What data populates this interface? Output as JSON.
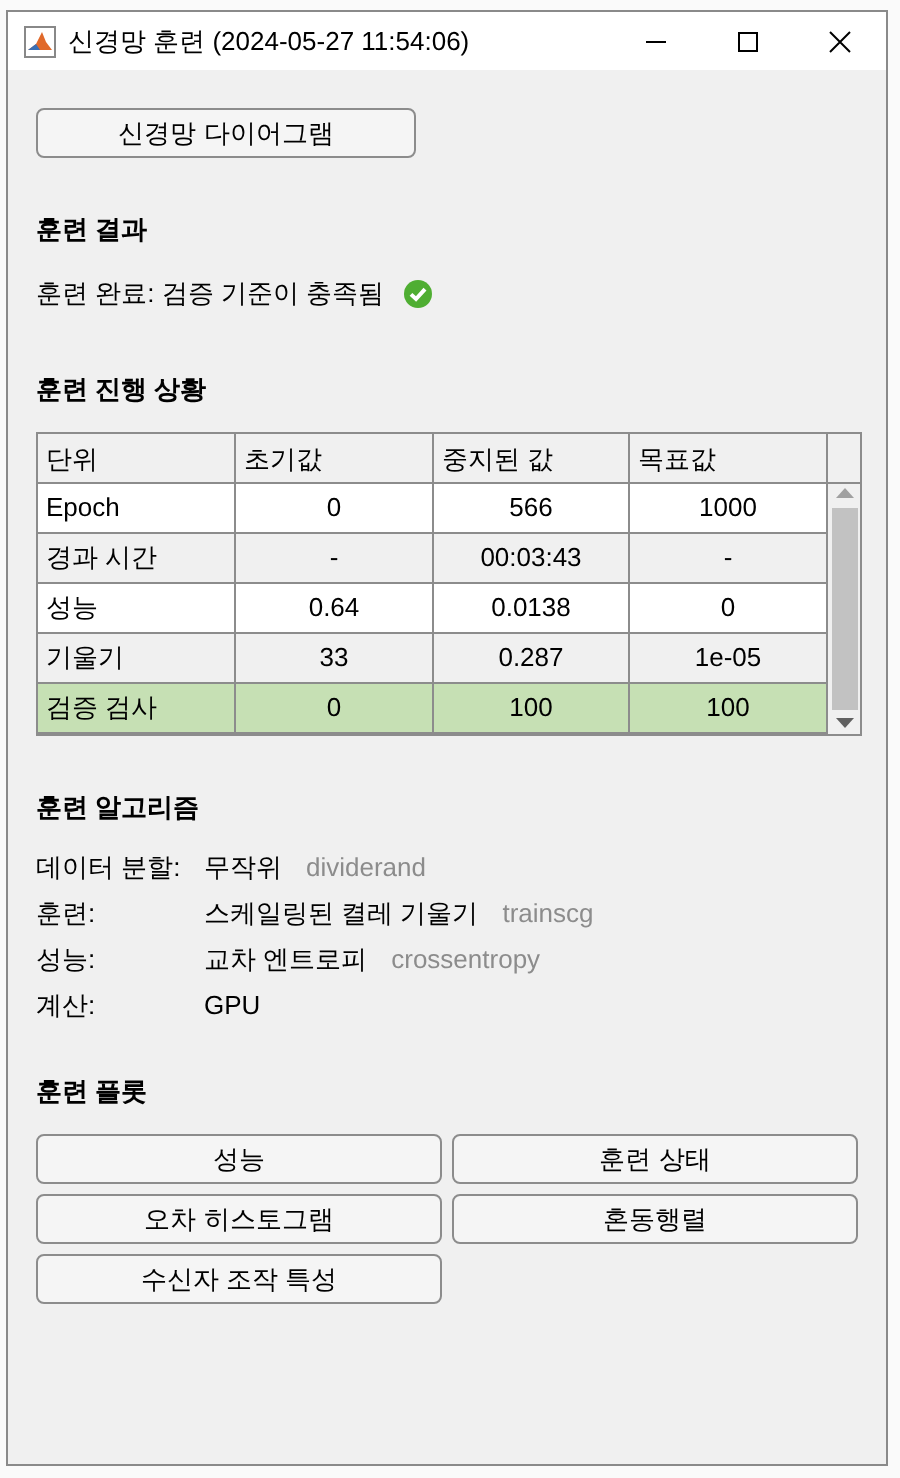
{
  "window": {
    "title": "신경망 훈련 (2024-05-27 11:54:06)"
  },
  "diagram_button": "신경망 다이어그램",
  "results": {
    "heading": "훈련 결과",
    "message": "훈련 완료: 검증 기준이 충족됨",
    "success": true
  },
  "progress": {
    "heading": "훈련 진행 상황",
    "columns": [
      "단위",
      "초기값",
      "중지된 값",
      "목표값"
    ],
    "rows": [
      {
        "cells": [
          "Epoch",
          "0",
          "566",
          "1000"
        ],
        "highlighted": false
      },
      {
        "cells": [
          "경과 시간",
          "-",
          "00:03:43",
          "-"
        ],
        "highlighted": false
      },
      {
        "cells": [
          "성능",
          "0.64",
          "0.0138",
          "0"
        ],
        "highlighted": false
      },
      {
        "cells": [
          "기울기",
          "33",
          "0.287",
          "1e-05"
        ],
        "highlighted": false
      },
      {
        "cells": [
          "검증 검사",
          "0",
          "100",
          "100"
        ],
        "highlighted": true
      }
    ]
  },
  "algorithms": {
    "heading": "훈련 알고리즘",
    "items": [
      {
        "label": "데이터 분할:",
        "value": "무작위",
        "function": "dividerand"
      },
      {
        "label": "훈련:",
        "value": "스케일링된 켤레 기울기",
        "function": "trainscg"
      },
      {
        "label": "성능:",
        "value": "교차 엔트로피",
        "function": "crossentropy"
      },
      {
        "label": "계산:",
        "value": "GPU"
      }
    ]
  },
  "plots": {
    "heading": "훈련 플롯",
    "buttons": [
      "성능",
      "훈련 상태",
      "오차 히스토그램",
      "혼동행렬",
      "수신자 조작 특성"
    ]
  }
}
